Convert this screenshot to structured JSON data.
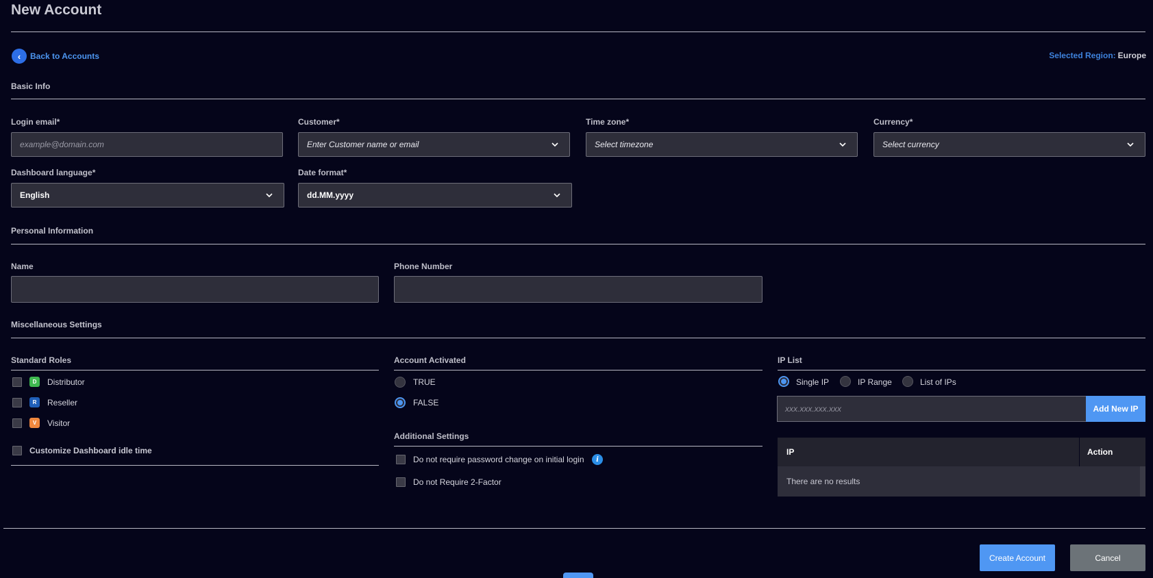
{
  "page": {
    "title": "New Account"
  },
  "nav": {
    "back_label": "Back to Accounts"
  },
  "region": {
    "label": "Selected Region:",
    "value": "Europe"
  },
  "basic_info": {
    "heading": "Basic Info",
    "login_email": {
      "label": "Login email*",
      "placeholder": "example@domain.com"
    },
    "customer": {
      "label": "Customer*",
      "placeholder": "Enter Customer name or email"
    },
    "time_zone": {
      "label": "Time zone*",
      "placeholder": "Select timezone"
    },
    "currency": {
      "label": "Currency*",
      "placeholder": "Select currency"
    },
    "dashboard_language": {
      "label": "Dashboard language*",
      "value": "English"
    },
    "date_format": {
      "label": "Date format*",
      "value": "dd.MM.yyyy"
    }
  },
  "personal_info": {
    "heading": "Personal Information",
    "name": {
      "label": "Name",
      "value": ""
    },
    "phone": {
      "label": "Phone Number",
      "value": ""
    }
  },
  "misc": {
    "heading": "Miscellaneous Settings",
    "standard_roles": {
      "heading": "Standard Roles",
      "roles": [
        {
          "badge": "D",
          "label": "Distributor",
          "color": "#3fb950",
          "checked": false
        },
        {
          "badge": "R",
          "label": "Reseller",
          "color": "#1f5fb8",
          "checked": false
        },
        {
          "badge": "V",
          "label": "Visitor",
          "color": "#f0883e",
          "checked": false
        }
      ],
      "customize_idle": "Customize Dashboard idle time"
    },
    "account_activated": {
      "heading": "Account Activated",
      "options": [
        {
          "label": "TRUE",
          "selected": false
        },
        {
          "label": "FALSE",
          "selected": true
        }
      ]
    },
    "additional_settings": {
      "heading": "Additional Settings",
      "items": [
        {
          "label": "Do not require password change on initial login",
          "checked": false
        },
        {
          "label": "Do not Require 2-Factor",
          "checked": false
        }
      ]
    },
    "ip_list": {
      "heading": "IP List",
      "modes": [
        {
          "label": "Single IP",
          "selected": true
        },
        {
          "label": "IP Range",
          "selected": false
        },
        {
          "label": "List of IPs",
          "selected": false
        }
      ],
      "input_placeholder": "xxx.xxx.xxx.xxx",
      "add_button": "Add New IP",
      "table": {
        "columns": [
          "IP",
          "Action"
        ],
        "empty_message": "There are no results"
      }
    }
  },
  "footer": {
    "create_button": "Create Account",
    "cancel_button": "Cancel"
  },
  "colors": {
    "accent": "#4f97f3",
    "background": "#05051a",
    "field": "#2e2e3a"
  }
}
